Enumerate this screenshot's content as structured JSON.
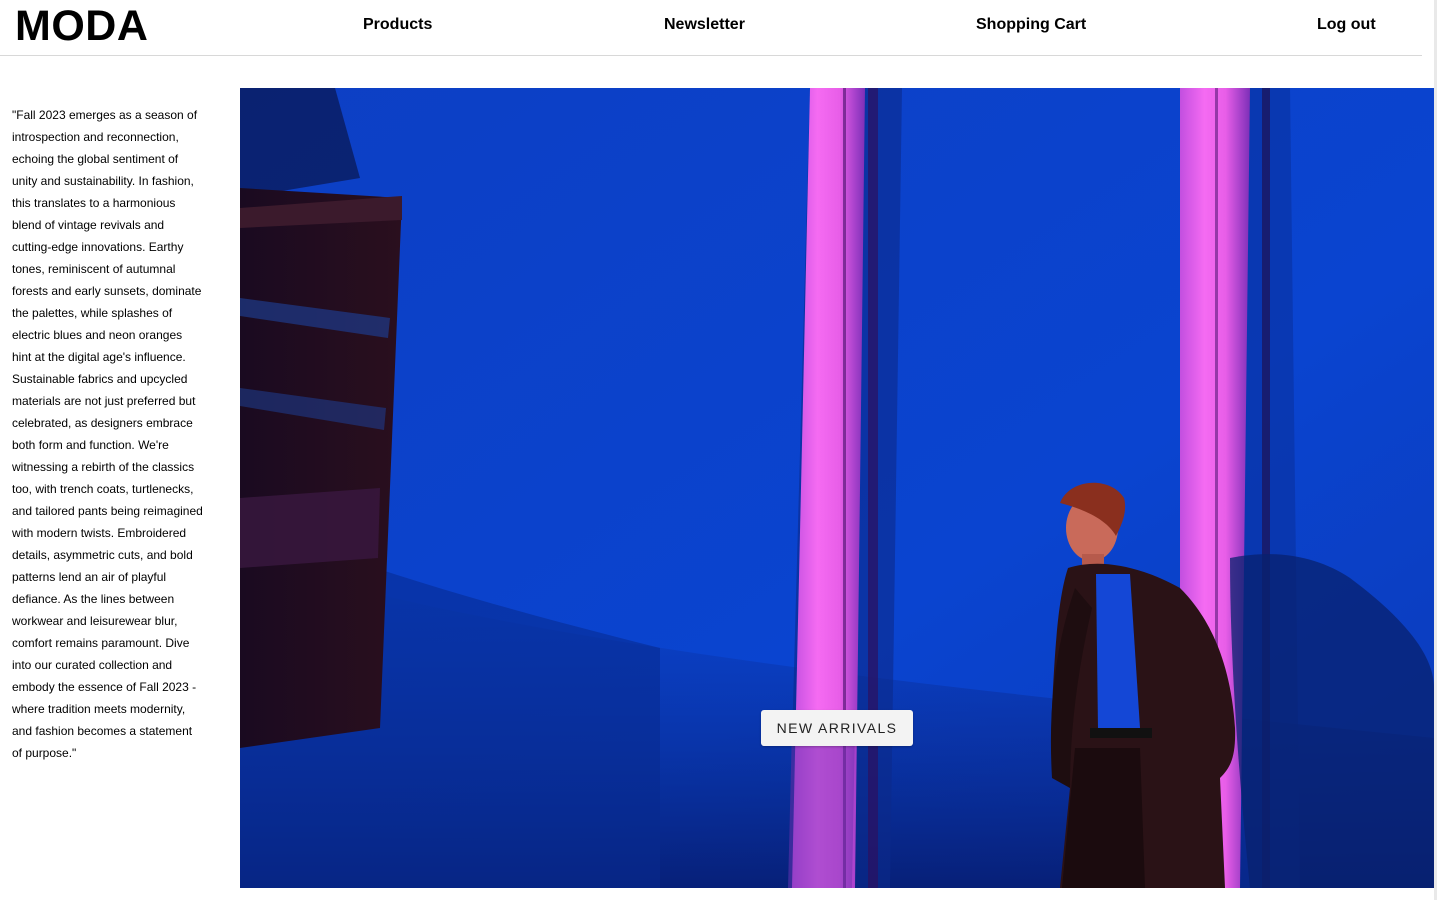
{
  "brand": {
    "name": "MODA"
  },
  "nav": {
    "products": "Products",
    "newsletter": "Newsletter",
    "cart": "Shopping Cart",
    "logout": "Log out"
  },
  "intro": {
    "text": "\"Fall 2023 emerges as a season of introspection and reconnection, echoing the global sentiment of unity and sustainability. In fashion, this translates to a harmonious blend of vintage revivals and cutting-edge innovations. Earthy tones, reminiscent of autumnal forests and early sunsets, dominate the palettes, while splashes of electric blues and neon oranges hint at the digital age's influence. Sustainable fabrics and upcycled materials are not just preferred but celebrated, as designers embrace both form and function. We're witnessing a rebirth of the classics too, with trench coats, turtlenecks, and tailored pants being reimagined with modern twists. Embroidered details, asymmetric cuts, and bold patterns lend an air of playful defiance. As the lines between workwear and leisurewear blur, comfort remains paramount. Dive into our curated collection and embody the essence of Fall 2023 - where tradition meets modernity, and fashion becomes a statement of purpose.\""
  },
  "hero": {
    "cta_label": "NEW ARRIVALS",
    "colors": {
      "wall": "#0a3fc6",
      "neon": "#f05ff0",
      "shadow": "#0b1f6e",
      "jacket": "#2a1216"
    }
  }
}
